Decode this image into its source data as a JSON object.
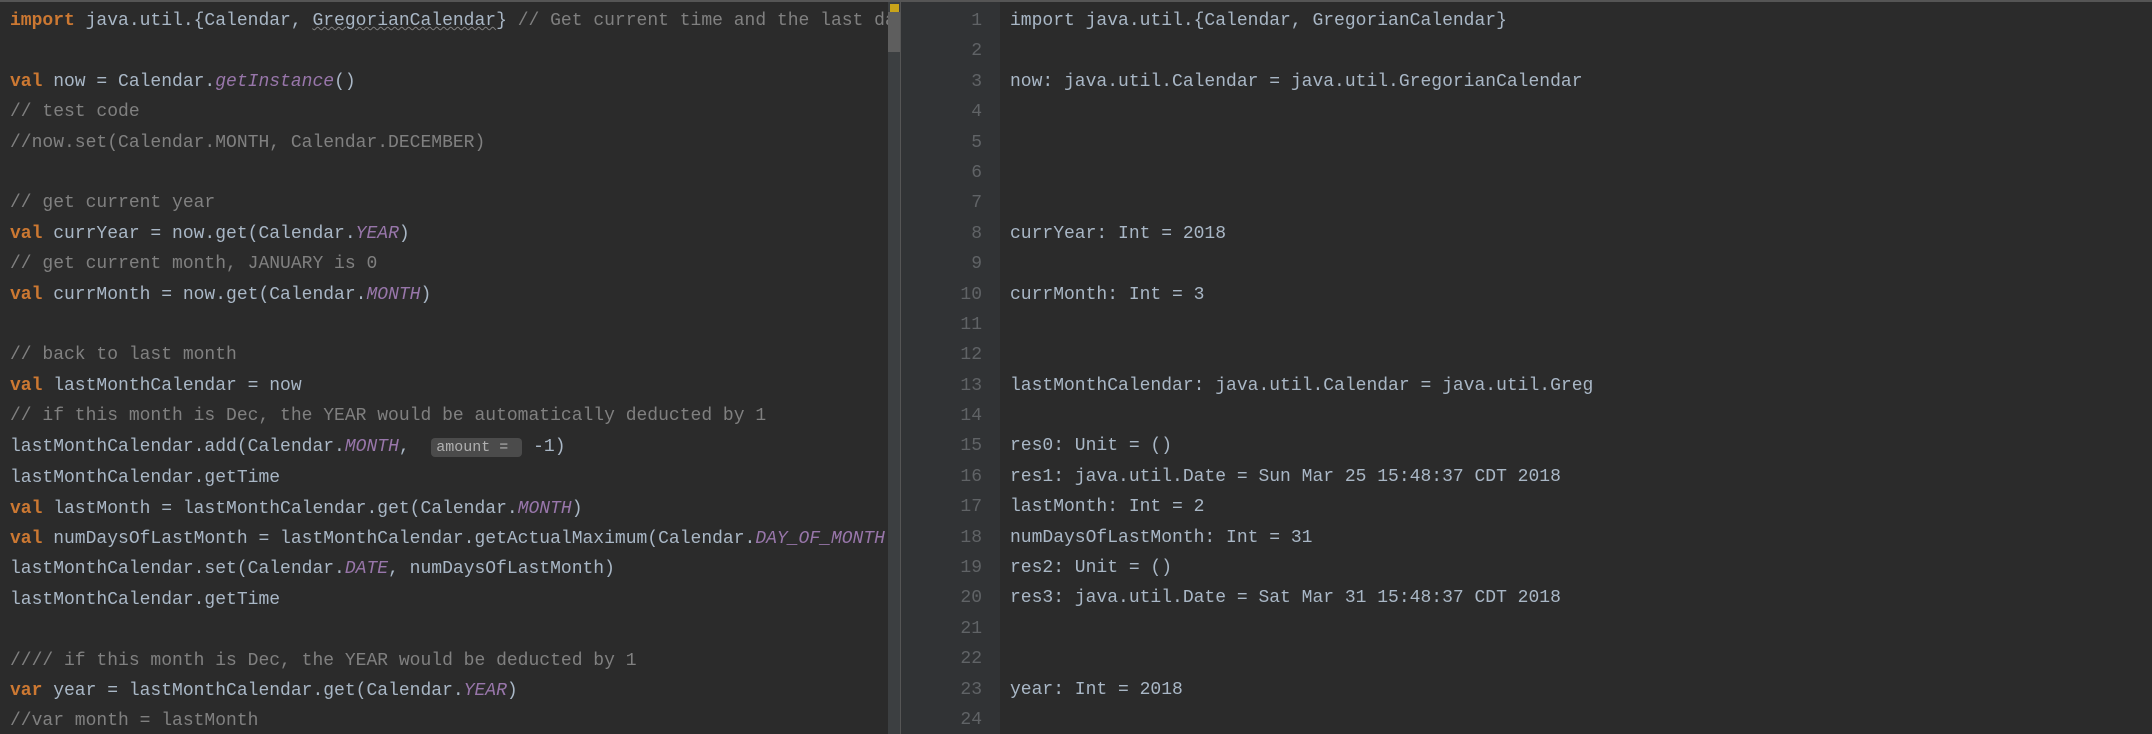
{
  "editor": {
    "lines": [
      [
        {
          "t": "import",
          "c": "kw"
        },
        {
          "t": " java.util.{Calendar, "
        },
        {
          "t": "GregorianCalendar",
          "c": "wavy"
        },
        {
          "t": "} "
        },
        {
          "t": "// Get current time and the last date ",
          "c": "comment"
        }
      ],
      [
        {
          "t": ""
        }
      ],
      [
        {
          "t": "val",
          "c": "kw"
        },
        {
          "t": " now = Calendar."
        },
        {
          "t": "getInstance",
          "c": "str-ital"
        },
        {
          "t": "()"
        }
      ],
      [
        {
          "t": "// test code",
          "c": "comment"
        }
      ],
      [
        {
          "t": "//now.set(Calendar.MONTH, Calendar.DECEMBER)",
          "c": "comment"
        }
      ],
      [
        {
          "t": ""
        }
      ],
      [
        {
          "t": "// get current year",
          "c": "comment"
        }
      ],
      [
        {
          "t": "val",
          "c": "kw"
        },
        {
          "t": " currYear = now.get(Calendar."
        },
        {
          "t": "YEAR",
          "c": "str-ital"
        },
        {
          "t": ")"
        }
      ],
      [
        {
          "t": "// get current month, JANUARY is 0",
          "c": "comment"
        }
      ],
      [
        {
          "t": "val",
          "c": "kw"
        },
        {
          "t": " currMonth = now.get(Calendar."
        },
        {
          "t": "MONTH",
          "c": "str-ital"
        },
        {
          "t": ")"
        }
      ],
      [
        {
          "t": ""
        }
      ],
      [
        {
          "t": "// back to last month",
          "c": "comment"
        }
      ],
      [
        {
          "t": "val",
          "c": "kw"
        },
        {
          "t": " lastMonthCalendar = now"
        }
      ],
      [
        {
          "t": "// if this month is Dec, the YEAR would be automatically deducted by 1",
          "c": "comment"
        }
      ],
      [
        {
          "t": "lastMonthCalendar.add(Calendar."
        },
        {
          "t": "MONTH",
          "c": "str-ital"
        },
        {
          "t": ",  "
        },
        {
          "t": "amount = ",
          "c": "hint"
        },
        {
          "t": " -1)"
        }
      ],
      [
        {
          "t": "lastMonthCalendar.getTime"
        }
      ],
      [
        {
          "t": "val",
          "c": "kw"
        },
        {
          "t": " lastMonth = lastMonthCalendar.get(Calendar."
        },
        {
          "t": "MONTH",
          "c": "str-ital"
        },
        {
          "t": ")"
        }
      ],
      [
        {
          "t": "val",
          "c": "kw"
        },
        {
          "t": " numDaysOfLastMonth = lastMonthCalendar.getActualMaximum(Calendar."
        },
        {
          "t": "DAY_OF_MONTH",
          "c": "str-ital"
        },
        {
          "t": ")"
        }
      ],
      [
        {
          "t": "lastMonthCalendar.set(Calendar."
        },
        {
          "t": "DATE",
          "c": "str-ital"
        },
        {
          "t": ", numDaysOfLastMonth)"
        }
      ],
      [
        {
          "t": "lastMonthCalendar.getTime"
        }
      ],
      [
        {
          "t": ""
        }
      ],
      [
        {
          "t": "//// if this month is Dec, the YEAR would be deducted by 1",
          "c": "comment"
        }
      ],
      [
        {
          "t": "var",
          "c": "kw"
        },
        {
          "t": " year = lastMonthCalendar.get(Calendar."
        },
        {
          "t": "YEAR",
          "c": "str-ital"
        },
        {
          "t": ")"
        }
      ],
      [
        {
          "t": "//var month = lastMonth",
          "c": "comment"
        }
      ]
    ]
  },
  "gutter": {
    "start": 1,
    "end": 24
  },
  "output": {
    "lines": [
      "import java.util.{Calendar, GregorianCalendar}",
      "",
      "now: java.util.Calendar = java.util.GregorianCalendar",
      "",
      "",
      "",
      "",
      "currYear: Int = 2018",
      "",
      "currMonth: Int = 3",
      "",
      "",
      "lastMonthCalendar: java.util.Calendar = java.util.Greg",
      "",
      "res0: Unit = ()",
      "res1: java.util.Date = Sun Mar 25 15:48:37 CDT 2018",
      "lastMonth: Int = 2",
      "numDaysOfLastMonth: Int = 31",
      "res2: Unit = ()",
      "res3: java.util.Date = Sat Mar 31 15:48:37 CDT 2018",
      "",
      "",
      "year: Int = 2018",
      ""
    ]
  }
}
